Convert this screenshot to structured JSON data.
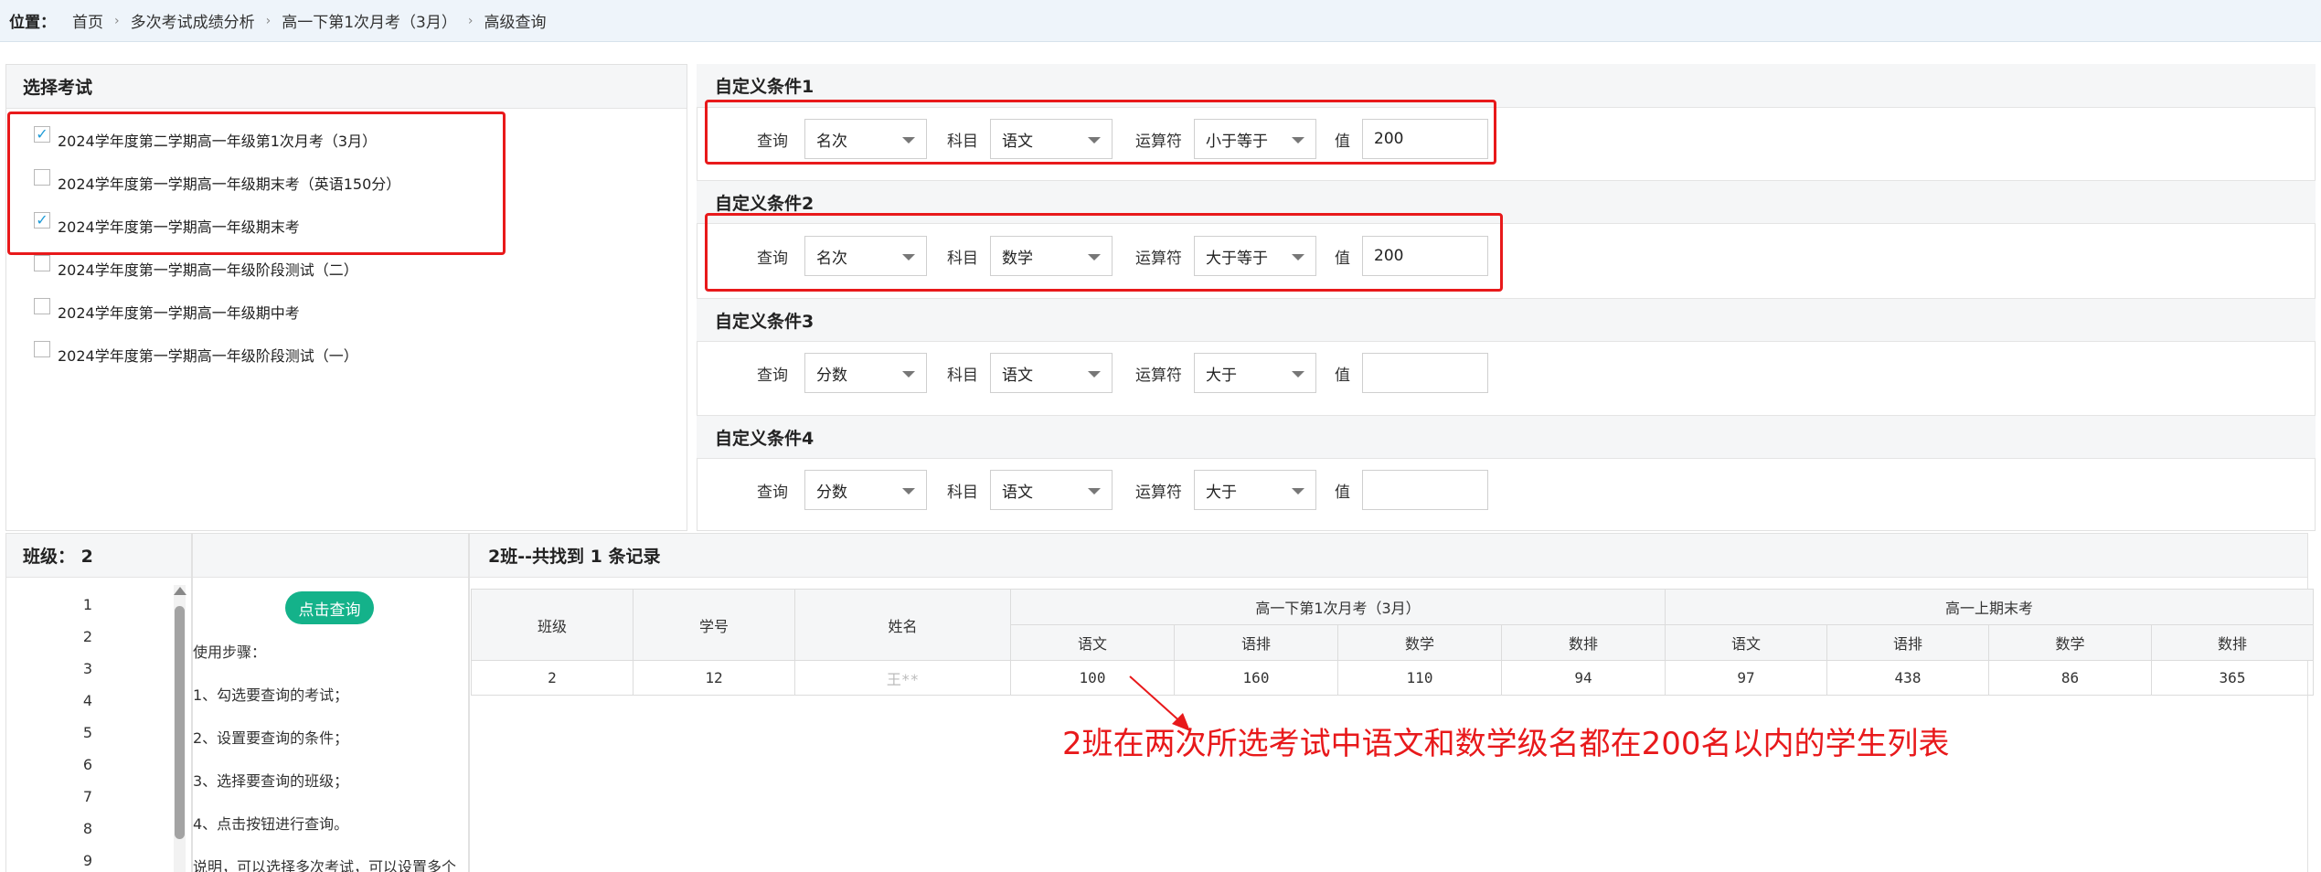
{
  "breadcrumb": {
    "label": "位置：",
    "items": [
      "首页",
      "多次考试成绩分析",
      "高一下第1次月考（3月）",
      "高级查询"
    ]
  },
  "exam_panel": {
    "title": "选择考试",
    "exams": [
      {
        "label": "2024学年度第二学期高一年级第1次月考（3月）",
        "checked": true
      },
      {
        "label": "2024学年度第一学期高一年级期末考（英语150分）",
        "checked": false
      },
      {
        "label": "2024学年度第一学期高一年级期末考",
        "checked": true
      },
      {
        "label": "2024学年度第一学期高一年级阶段测试（二）",
        "checked": false
      },
      {
        "label": "2024学年度第一学期高一年级期中考",
        "checked": false
      },
      {
        "label": "2024学年度第一学期高一年级阶段测试（一）",
        "checked": false
      }
    ],
    "check_mark": "✓"
  },
  "conditions": [
    {
      "title": "自定义条件1",
      "query_label": "查询",
      "query": "名次",
      "subject_label": "科目",
      "subject": "语文",
      "op_label": "运算符",
      "op": "小于等于",
      "value_label": "值",
      "value": "200"
    },
    {
      "title": "自定义条件2",
      "query_label": "查询",
      "query": "名次",
      "subject_label": "科目",
      "subject": "数学",
      "op_label": "运算符",
      "op": "大于等于",
      "value_label": "值",
      "value": "200"
    },
    {
      "title": "自定义条件3",
      "query_label": "查询",
      "query": "分数",
      "subject_label": "科目",
      "subject": "语文",
      "op_label": "运算符",
      "op": "大于",
      "value_label": "值",
      "value": ""
    },
    {
      "title": "自定义条件4",
      "query_label": "查询",
      "query": "分数",
      "subject_label": "科目",
      "subject": "语文",
      "op_label": "运算符",
      "op": "大于",
      "value_label": "值",
      "value": ""
    }
  ],
  "class_panel": {
    "title": "班级：  2",
    "classes": [
      "1",
      "2",
      "3",
      "4",
      "5",
      "6",
      "7",
      "8",
      "9"
    ]
  },
  "help": {
    "button": "点击查询",
    "steps": [
      "使用步骤：",
      "1、勾选要查询的考试；",
      "2、设置要查询的条件；",
      "3、选择要查询的班级；",
      "4、点击按钮进行查询。",
      "说明，可以选择多次考试，可以设置多个"
    ]
  },
  "results": {
    "title": "2班--共找到 1 条记录",
    "headers": {
      "class": "班级",
      "student_id": "学号",
      "name": "姓名",
      "exam1": "高一下第1次月考（3月）",
      "exam2": "高一上期末考",
      "sub_cols": [
        "语文",
        "语排",
        "数学",
        "数排"
      ]
    },
    "rows": [
      {
        "class": "2",
        "student_id": "12",
        "name": "王**",
        "exam1": [
          "100",
          "160",
          "110",
          "94"
        ],
        "exam2": [
          "97",
          "438",
          "86",
          "365"
        ]
      }
    ]
  },
  "annotation": "2班在两次所选考试中语文和数学级名都在200名以内的学生列表",
  "colors": {
    "accent_green": "#14b28a",
    "annotation_red": "#e8191b",
    "check_blue": "#1e9bd7"
  }
}
